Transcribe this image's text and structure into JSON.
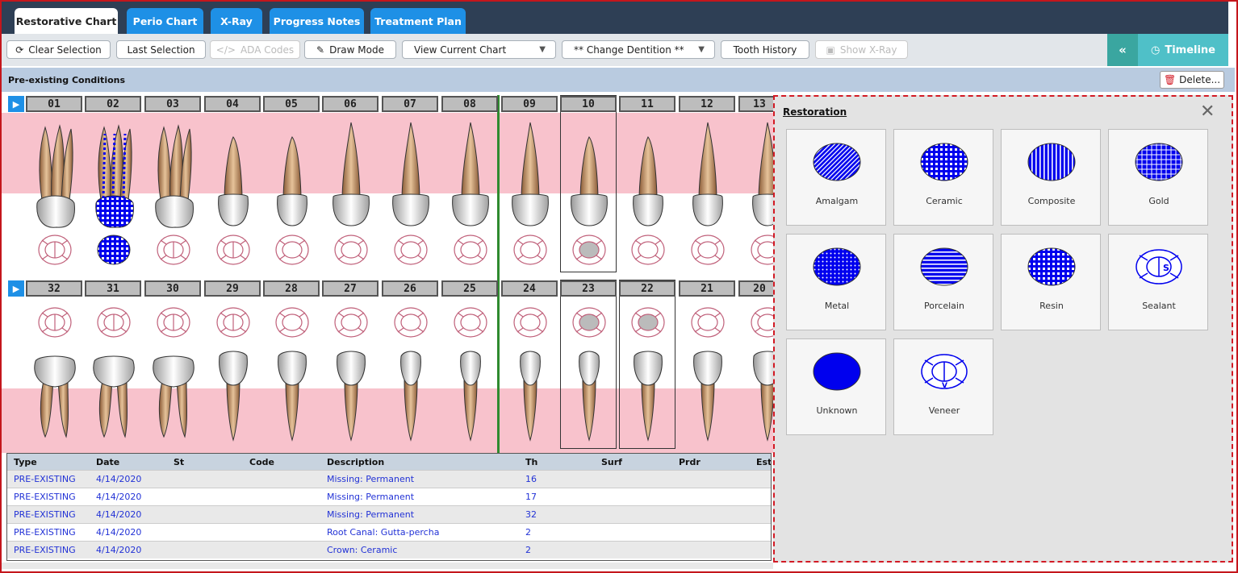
{
  "tabs": [
    {
      "label": "Restorative Chart",
      "active": true
    },
    {
      "label": "Perio Chart"
    },
    {
      "label": "X-Ray"
    },
    {
      "label": "Progress Notes"
    },
    {
      "label": "Treatment Plan"
    }
  ],
  "toolbar": {
    "clear_label": "Clear Selection",
    "last_label": "Last Selection",
    "ada_label": "ADA Codes",
    "draw_label": "Draw Mode",
    "view_select": "View Current Chart",
    "dentition_select": "** Change Dentition **",
    "history_label": "Tooth History",
    "xray_label": "Show X-Ray"
  },
  "side": {
    "collapse": "«",
    "timeline_label": "Timeline"
  },
  "conditions": {
    "title": "Pre-existing Conditions",
    "delete_label": "Delete..."
  },
  "upper_teeth": [
    "01",
    "02",
    "03",
    "04",
    "05",
    "06",
    "07",
    "08",
    "09",
    "10",
    "11",
    "12",
    "13"
  ],
  "lower_teeth": [
    "32",
    "31",
    "30",
    "29",
    "28",
    "27",
    "26",
    "25",
    "24",
    "23",
    "22",
    "21",
    "20"
  ],
  "ledger": {
    "headers": [
      "Type",
      "Date",
      "St",
      "Code",
      "Description",
      "Th",
      "Surf",
      "Prdr",
      "Est"
    ],
    "rows": [
      [
        "PRE-EXISTING",
        "4/14/2020",
        "",
        "",
        "Missing: Permanent",
        "16",
        "",
        "",
        ""
      ],
      [
        "PRE-EXISTING",
        "4/14/2020",
        "",
        "",
        "Missing: Permanent",
        "17",
        "",
        "",
        ""
      ],
      [
        "PRE-EXISTING",
        "4/14/2020",
        "",
        "",
        "Missing: Permanent",
        "32",
        "",
        "",
        ""
      ],
      [
        "PRE-EXISTING",
        "4/14/2020",
        "",
        "",
        "Root Canal:  Gutta-percha",
        "2",
        "",
        "",
        ""
      ],
      [
        "PRE-EXISTING",
        "4/14/2020",
        "",
        "",
        "Crown:  Ceramic",
        "2",
        "",
        "",
        ""
      ]
    ]
  },
  "panel": {
    "title": "Restoration",
    "close": "✕",
    "materials": [
      "Amalgam",
      "Ceramic",
      "Composite",
      "Gold",
      "Metal",
      "Porcelain",
      "Resin",
      "Sealant",
      "Unknown",
      "Veneer"
    ]
  },
  "colors": {
    "accent": "#1e90e6",
    "header": "#2e3f55",
    "gum": "#f8c2cc",
    "restoration": "#0000ee",
    "teal": "#4fc0c8"
  }
}
